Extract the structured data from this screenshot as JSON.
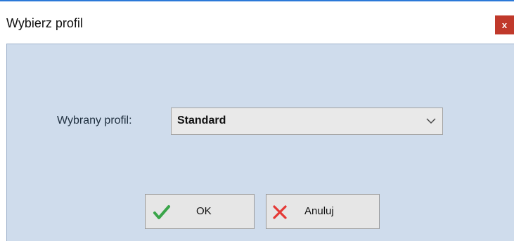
{
  "window": {
    "title": "Wybierz profil",
    "close_label": "x"
  },
  "form": {
    "profile_label": "Wybrany profil:",
    "profile_value": "Standard"
  },
  "buttons": {
    "ok_label": "OK",
    "cancel_label": "Anuluj"
  },
  "icons": {
    "dropdown": "chevron-down-icon",
    "ok": "checkmark-icon",
    "cancel": "cross-icon",
    "close": "close-icon"
  },
  "colors": {
    "content_bg": "#cfdcec",
    "close_bg": "#c0392b",
    "ok_icon": "#3aa54a",
    "cancel_icon": "#e53935",
    "accent": "#2b79d8"
  }
}
